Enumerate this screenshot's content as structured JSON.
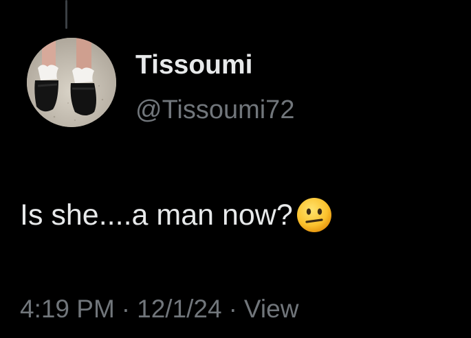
{
  "author": {
    "display_name": "Tissoumi",
    "handle": "@Tissoumi72",
    "avatar_icon": "avatar-photo-feet-frilly-socks-mary-janes"
  },
  "tweet": {
    "text": "Is she....a man now?",
    "emoji": "neutral-face-emoji"
  },
  "meta": {
    "time": "4:19 PM",
    "separator": "·",
    "date": "12/1/24",
    "views_label": "View"
  },
  "colors": {
    "background": "#000000",
    "primary_text": "#e7e9ea",
    "secondary_text": "#71767b",
    "thread_line": "#3b3f44"
  }
}
